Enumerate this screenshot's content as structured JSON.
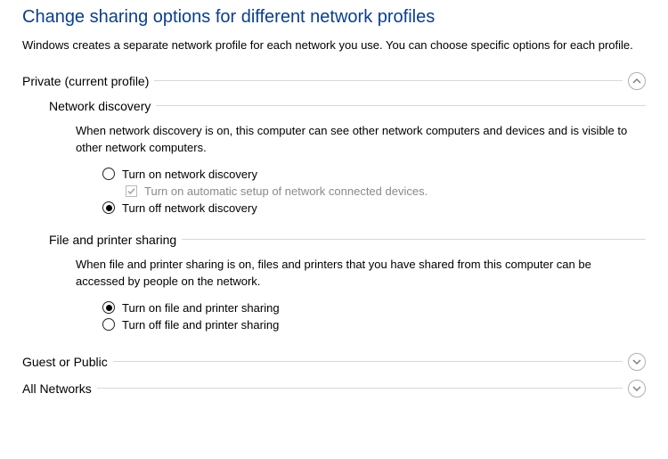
{
  "title": "Change sharing options for different network profiles",
  "description": "Windows creates a separate network profile for each network you use. You can choose specific options for each profile.",
  "private": {
    "header": "Private (current profile)",
    "expanded": true,
    "network_discovery": {
      "heading": "Network discovery",
      "desc": "When network discovery is on, this computer can see other network computers and devices and is visible to other network computers.",
      "on_label": "Turn on network discovery",
      "auto_setup_label": "Turn on automatic setup of network connected devices.",
      "off_label": "Turn off network discovery",
      "selected": "off",
      "auto_setup_checked": true,
      "auto_setup_enabled": false
    },
    "file_printer": {
      "heading": "File and printer sharing",
      "desc": "When file and printer sharing is on, files and printers that you have shared from this computer can be accessed by people on the network.",
      "on_label": "Turn on file and printer sharing",
      "off_label": "Turn off file and printer sharing",
      "selected": "on"
    }
  },
  "guest": {
    "header": "Guest or Public",
    "expanded": false
  },
  "all": {
    "header": "All Networks",
    "expanded": false
  }
}
